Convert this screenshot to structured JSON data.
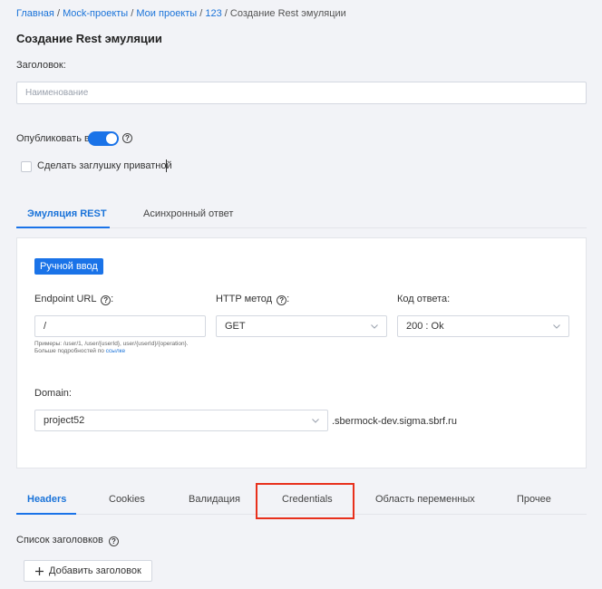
{
  "breadcrumb": {
    "items": [
      "Главная",
      "Mock-проекты",
      "Мои проекты",
      "123"
    ],
    "current": "Создание Rest эмуляции",
    "separator": "/"
  },
  "page": {
    "title": "Создание Rest эмуляции"
  },
  "form": {
    "title_label": "Заголовок:",
    "title_placeholder": "Наименование",
    "publish_label": "Опубликовать в",
    "publish_on": true,
    "private_label": "Сделать заглушку приватной",
    "private_checked": false
  },
  "top_tabs": {
    "items": [
      "Эмуляция REST",
      "Асинхронный ответ"
    ],
    "active": 0
  },
  "emulation": {
    "manual_input_label": "Ручной ввод",
    "endpoint_label": "Endpoint URL",
    "endpoint_suffix": ":",
    "endpoint_value": "/",
    "endpoint_hint": "Примеры: /user/1, /user/{userId}, user/{userId}/{operation}. Больше подробностей по",
    "endpoint_hint_link": "ссылке",
    "method_label": "HTTP метод",
    "method_suffix": ":",
    "method_value": "GET",
    "code_label": "Код ответа:",
    "code_value": "200 : Ok",
    "domain_label": "Domain:",
    "domain_value": "project52",
    "domain_suffix": ".sbermock-dev.sigma.sbrf.ru"
  },
  "bottom_tabs": {
    "items": [
      "Headers",
      "Cookies",
      "Валидация",
      "Credentials",
      "Область переменных",
      "Прочее"
    ],
    "active": 0,
    "highlighted": 3
  },
  "headers_section": {
    "list_label": "Список заголовков",
    "add_label": "Добавить заголовок"
  },
  "colors": {
    "accent": "#1a73e8",
    "highlight": "#e8301c",
    "background": "#f2f3f7"
  }
}
